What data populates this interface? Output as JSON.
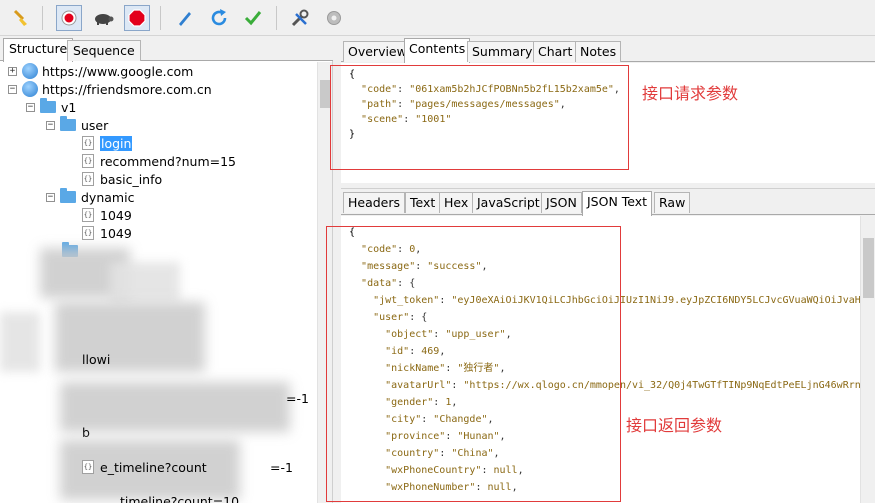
{
  "toolbar": {
    "buttons": [
      {
        "icon": "broom-icon"
      },
      {
        "icon": "record-icon"
      },
      {
        "icon": "turtle-icon"
      },
      {
        "icon": "stop-icon"
      },
      {
        "icon": "pen-icon"
      },
      {
        "icon": "refresh-icon"
      },
      {
        "icon": "check-icon"
      },
      {
        "icon": "tools-icon"
      },
      {
        "icon": "settings-icon"
      }
    ]
  },
  "left_tabs": [
    "Structure",
    "Sequence"
  ],
  "tree": {
    "hosts": [
      "https://www.google.com",
      "https://friendsmore.com.cn"
    ],
    "v1": "v1",
    "user": "user",
    "user_items": [
      "login",
      "recommend?num=15",
      "basic_info"
    ],
    "dynamic": "dynamic",
    "dynamic_items": [
      "1049",
      "1049"
    ],
    "partial": [
      "llowi",
      "=-1",
      "b",
      "e_timeline?count",
      "=-1",
      "timeline?count=10"
    ]
  },
  "request_tabs": [
    "Overview",
    "Contents",
    "Summary",
    "Chart",
    "Notes"
  ],
  "request_json": {
    "open": "{",
    "code_key": "\"code\"",
    "code_val": "\"061xam5b2hJCfPOBNn5b2fL15b2xam5e\"",
    "path_key": "\"path\"",
    "path_val": "\"pages/messages/messages\"",
    "scene_key": "\"scene\"",
    "scene_val": "\"1001\"",
    "close": "}"
  },
  "response_tabs": [
    "Headers",
    "Text",
    "Hex",
    "JavaScript",
    "JSON",
    "JSON Text",
    "Raw"
  ],
  "response_json": {
    "open": "{",
    "code_key": "\"code\"",
    "code_val": "0",
    "message_key": "\"message\"",
    "message_val": "\"success\"",
    "data_key": "\"data\"",
    "jwt_key": "\"jwt_token\"",
    "jwt_val": "\"eyJ0eXAiOiJKV1QiLCJhbGciOiJIUzI1NiJ9.eyJpZCI6NDY5LCJvcGVuaWQiOiJvaH",
    "user_key": "\"user\"",
    "object_key": "\"object\"",
    "object_val": "\"upp_user\"",
    "id_key": "\"id\"",
    "id_val": "469",
    "nick_key": "\"nickName\"",
    "nick_val": "\"独行者\"",
    "avatar_key": "\"avatarUrl\"",
    "avatar_val": "\"https://wx.qlogo.cn/mmopen/vi_32/Q0j4TwGTfTINp9NqEdtPeELjnG46wRrn",
    "gender_key": "\"gender\"",
    "gender_val": "1",
    "city_key": "\"city\"",
    "city_val": "\"Changde\"",
    "province_key": "\"province\"",
    "province_val": "\"Hunan\"",
    "country_key": "\"country\"",
    "country_val": "\"China\"",
    "wxcountry_key": "\"wxPhoneCountry\"",
    "wxcountry_val": "null",
    "wxphone_key": "\"wxPhoneNumber\"",
    "wxphone_val": "null"
  },
  "annotations": {
    "request_label": "接口请求参数",
    "response_label": "接口返回参数"
  },
  "colors": {
    "selection": "#3399ff",
    "annotation": "#e13b3b",
    "json_value": "#8b6914"
  }
}
